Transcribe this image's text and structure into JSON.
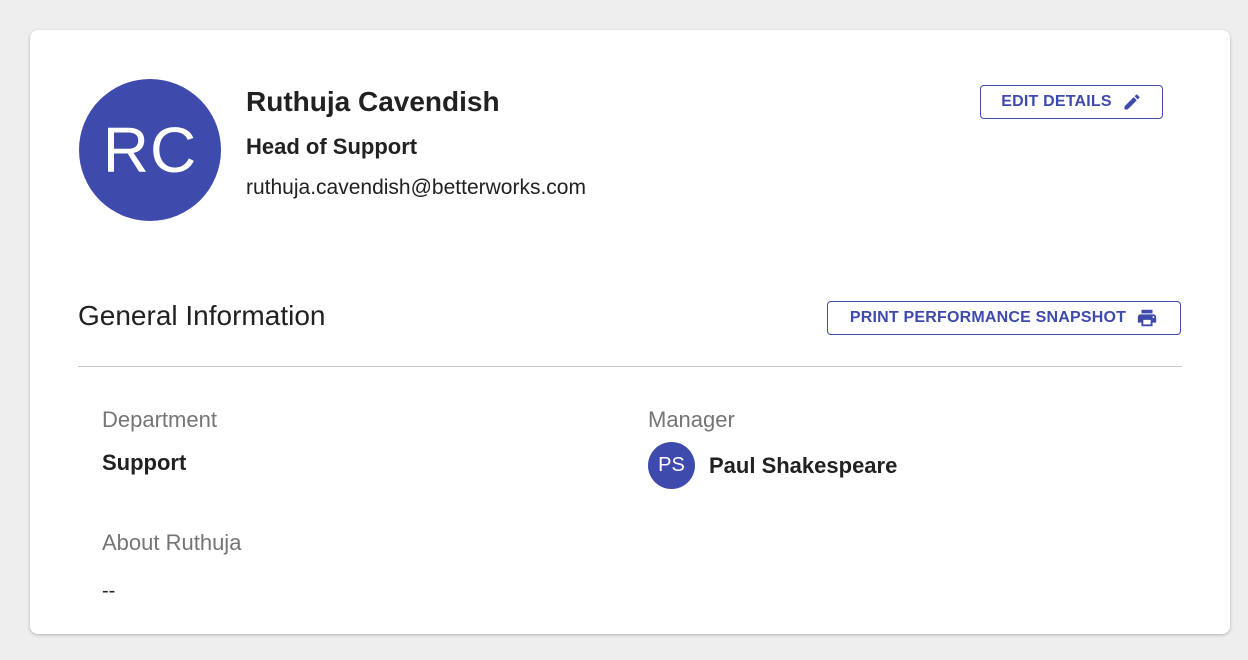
{
  "profile": {
    "initials": "RC",
    "name": "Ruthuja Cavendish",
    "title": "Head of Support",
    "email": "ruthuja.cavendish@betterworks.com",
    "avatar_color": "#3f4aad"
  },
  "actions": {
    "edit_label": "EDIT DETAILS",
    "edit_icon": "pencil-icon",
    "print_label": "PRINT PERFORMANCE SNAPSHOT",
    "print_icon": "printer-icon",
    "accent_color": "#3f4aad"
  },
  "general": {
    "section_title": "General Information",
    "department_label": "Department",
    "department_value": "Support",
    "manager_label": "Manager",
    "manager_initials": "PS",
    "manager_name": "Paul Shakespeare",
    "about_label": "About Ruthuja",
    "about_value": "--"
  }
}
